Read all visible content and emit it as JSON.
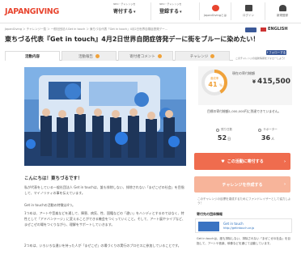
{
  "header": {
    "logo": "JAPANGIVING",
    "nav": [
      {
        "small": "NPO・チャレンジを",
        "big": "寄付する",
        "chev": "▾"
      },
      {
        "small": "NPO・チャレンジを",
        "big": "登録する",
        "chev": "▾"
      }
    ],
    "icons": [
      {
        "label": "JapanGivingとは"
      },
      {
        "label": "ログイン"
      },
      {
        "label": "新規登録"
      }
    ]
  },
  "breadcrumb": "JapanGiving ＞ チャレンジ一覧 ＞ 一般社団法人Get in touch ＞ 東ちづる代表「Get in touch」4月2日世界自閉症啓発デー…",
  "language": "ENGLISH",
  "title": "東ちづる代表『Get in touch』4月2日世界自閉症啓発デーに街をブルーに染めたい！",
  "tabs": [
    {
      "label": "活動内容",
      "badge": false
    },
    {
      "label": "活動報告",
      "badge": true
    },
    {
      "label": "寄付者コメント",
      "badge": true
    },
    {
      "label": "チャレンジ",
      "badge": true
    }
  ],
  "follow": {
    "button": "f フォローする",
    "text": "このチャレンジの最新情報をフォローしよう！"
  },
  "intro": "こんにちは！東ちづるです！",
  "paragraphs": [
    "私が代表をしている一般社団法人 Get in touchは、誰も排除しない、排除されない「まぜこぜの社会」を目指して、マイノリティの事を伝えています。",
    "Get in touchの活動の特徴は4つ。",
    "1つめは、アートや音楽などを通して、障害、病気、性、国籍などの「違い」をハンディとするのではなく、特性として「アドバンテージ」に変えることができる機会をつくっていくこと。そして、アート展やライブなど、まぜこぜの場をつくりながら、理解をサポートしていきます。",
    "2つめは、いろいろな違いを持った人が「まぜこぜ」の場づくりの実行のプロセスに参加していることです。"
  ],
  "funding": {
    "achieved_label": "達成率",
    "percent_text": "41",
    "percent_unit": "%",
    "raised_label": "現在の寄付総額",
    "currency": "¥",
    "amount": "415,500",
    "progress": 0.41
  },
  "goal_text": "目標の寄付総額1,000,000円に到達できていません。",
  "stats": [
    {
      "label": "残り日数",
      "value": "52",
      "unit": "日"
    },
    {
      "label": "サポーター",
      "value": "36",
      "unit": "人"
    }
  ],
  "buttons": {
    "support": "この活動に寄付する",
    "challenge": "チャレンジを作成する",
    "arrow": "›"
  },
  "fanclub": "このチャレンジの目標を達成するためにファンドレイザーとして協力しよう！",
  "organization": {
    "heading": "寄付先の団体情報",
    "name": "Get in touch",
    "url": "http://getintouch.or.jp",
    "desc": "Get in touchは、誰も排除しない、排除されない「まぜこぜの社会」を目指して、アートや音楽、映像などを通じて活動しています。"
  },
  "colors": {
    "brand": "#e8452f",
    "accent_orange": "#f0a23a",
    "support_button": "#ef6c4e",
    "challenge_button": "#f7b49a",
    "facebook": "#3b5998"
  }
}
